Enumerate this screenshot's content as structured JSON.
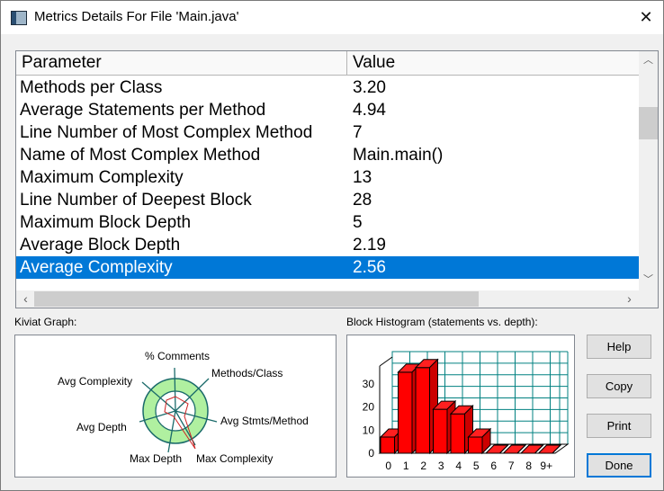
{
  "window": {
    "title": "Metrics Details For File 'Main.java'",
    "close_glyph": "✕"
  },
  "table": {
    "headers": [
      "Parameter",
      "Value"
    ],
    "rows": [
      {
        "param": "Methods per Class",
        "value": "3.20"
      },
      {
        "param": "Average Statements per Method",
        "value": "4.94"
      },
      {
        "param": "Line Number of Most Complex Method",
        "value": "7"
      },
      {
        "param": "Name of Most Complex Method",
        "value": "Main.main()"
      },
      {
        "param": "Maximum Complexity",
        "value": "13"
      },
      {
        "param": "Line Number of Deepest Block",
        "value": "28"
      },
      {
        "param": "Maximum Block Depth",
        "value": "5"
      },
      {
        "param": "Average Block Depth",
        "value": "2.19"
      },
      {
        "param": "Average Complexity",
        "value": "2.56"
      }
    ],
    "selected_row": "Average Complexity"
  },
  "kiviat": {
    "label": "Kiviat Graph:",
    "axes": [
      "% Comments",
      "Methods/Class",
      "Avg Stmts/Method",
      "Max Complexity",
      "Max Depth",
      "Avg Depth",
      "Avg Complexity"
    ]
  },
  "histogram": {
    "label": "Block Histogram (statements vs. depth):"
  },
  "buttons": {
    "help": "Help",
    "copy": "Copy",
    "print": "Print",
    "done": "Done"
  },
  "colors": {
    "selection": "#0078d7",
    "bar": "#ff0000",
    "grid": "#008080",
    "kiviat_band": "#b0f0a0"
  },
  "chart_data": {
    "type": "bar",
    "categories": [
      "0",
      "1",
      "2",
      "3",
      "4",
      "5",
      "6",
      "7",
      "8",
      "9+"
    ],
    "values": [
      7,
      35,
      37,
      19,
      17,
      7,
      0,
      0,
      0,
      0
    ],
    "yticks": [
      0,
      10,
      20,
      30
    ],
    "ylim": [
      0,
      40
    ]
  }
}
